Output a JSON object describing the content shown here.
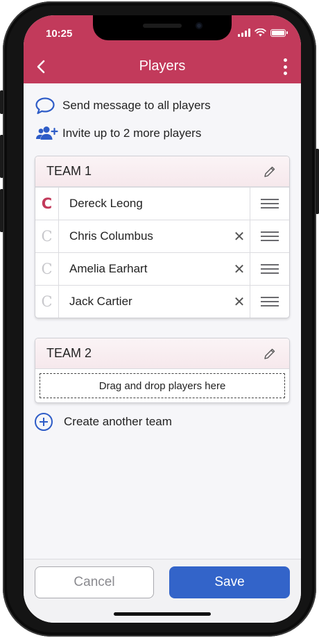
{
  "status_bar": {
    "time": "10:25"
  },
  "header": {
    "title": "Players",
    "back_icon": "chevron-left-icon",
    "menu_icon": "kebab-menu-icon"
  },
  "actions": {
    "message_all": "Send message to all players",
    "invite": "Invite up to 2 more players"
  },
  "teams": [
    {
      "name": "TEAM 1",
      "players": [
        {
          "captain_mark": "C",
          "name": "Dereck Leong",
          "is_captain": true
        },
        {
          "captain_mark": "C",
          "name": "Chris Columbus",
          "remove": "✕"
        },
        {
          "captain_mark": "C",
          "name": "Amelia Earhart",
          "remove": "✕"
        },
        {
          "captain_mark": "C",
          "name": "Jack Cartier",
          "remove": "✕"
        }
      ]
    },
    {
      "name": "TEAM 2",
      "dropzone": "Drag and drop players here"
    }
  ],
  "create_team": "Create another team",
  "footer": {
    "cancel": "Cancel",
    "save": "Save"
  },
  "colors": {
    "brand": "#c23a5b",
    "accent": "#3364c9"
  }
}
